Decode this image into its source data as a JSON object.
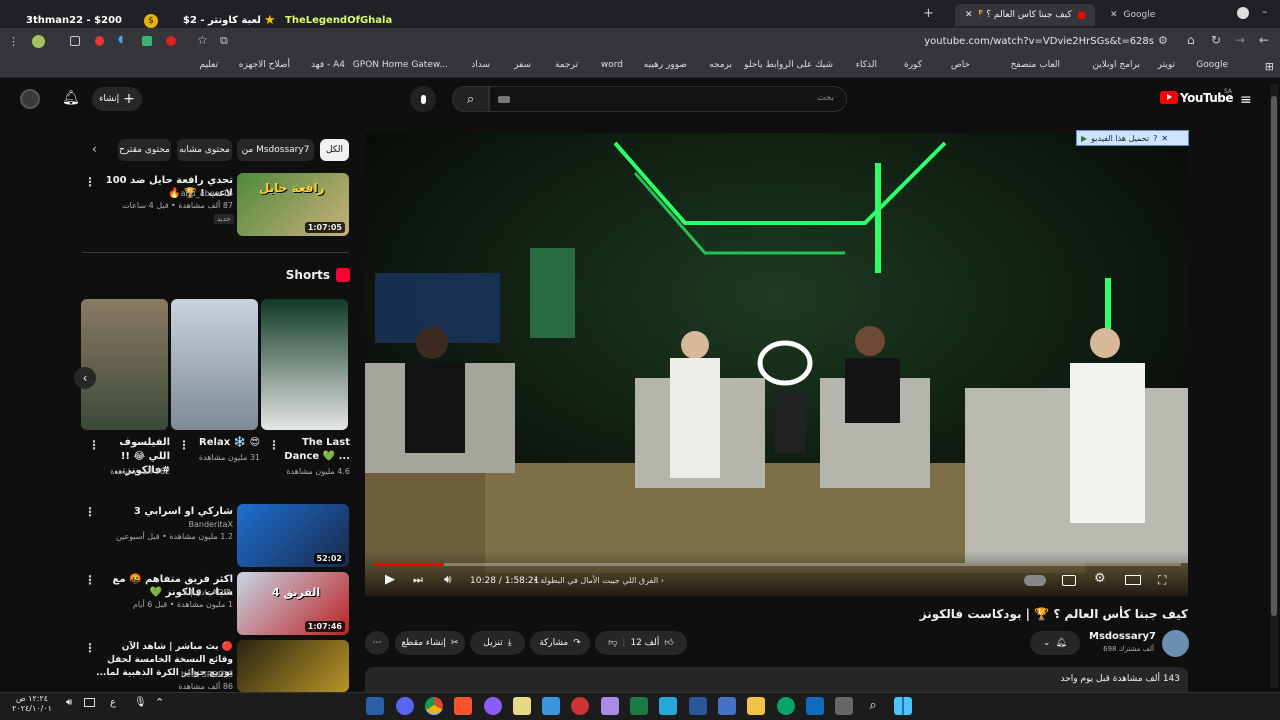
{
  "browser": {
    "tabs": [
      {
        "title": "كيف جبنا كأس العالم ؟ 🏆 | بودكا",
        "active": true
      },
      {
        "title": "Google",
        "active": false
      }
    ],
    "url": "youtube.com/watch?v=VDvie2HrSGs&t=628s",
    "bookmarks": [
      "Google",
      "تويتر",
      "برامج اونلاين",
      "العاب متصفح",
      "خاص",
      "كورة",
      "الذكاء",
      "شيك على الروابط ياحلو",
      "برمجه",
      "صوور رهيبه",
      "word",
      "ترجمة",
      "سفر",
      "سداد",
      "GPON Home Gatew...",
      "فهد - A4",
      "أصلاح الاجهزه",
      "تعليم"
    ]
  },
  "overlay": {
    "balance": "3thman22 - $200",
    "game": "لعبة كاونتر - 2$",
    "streamer": "TheLegendOfGhala"
  },
  "header": {
    "logo": "YouTube",
    "region": "SA",
    "search_placeholder": "بحث",
    "create_label": "إنشاء"
  },
  "player": {
    "time": "10:28 / 1:58:21",
    "chapter": "الفرق اللي جيبت الأمال في البطولة",
    "download_banner": "تحميل هذا الفيديو",
    "progress": 0.088
  },
  "video": {
    "title": "كيف جبنا كأس العالم ؟ 🏆 | بودكاست فالكونز",
    "channel": "Msdossary7",
    "subscribers": "698 ألف مشترك",
    "likes": "12 ألف",
    "share_label": "مشاركة",
    "download_label": "تنزيل",
    "clip_label": "إنشاء مقطع",
    "views_line": "143 ألف مشاهدة  قبل يوم واحد"
  },
  "chips": [
    "الكل",
    "من Msdossary7",
    "محتوى مشابه",
    "محتوى مقترح"
  ],
  "sidebar_videos": [
    {
      "title": "تحدي رافعة حايل ضد 100 لاعب ! 🏆 🔥",
      "channel": "abu_abeer16",
      "meta": "87 ألف مشاهدة • قبل 4 ساعات",
      "badge": "جديد",
      "duration": "1:07:05",
      "thumb_text": "رافعة حايل"
    },
    {
      "title": "شاركي او اسرابي 3",
      "channel": "BanderitaX",
      "meta": "1.2 مليون مشاهدة • قبل أسبوعين",
      "duration": "52:02"
    },
    {
      "title": "اكثر فريق متفاهم 🤬 مع شباب فالكونز 💚",
      "channel": "عادل | 3ADEL",
      "meta": "1 مليون مشاهدة • قبل 6 أيام",
      "duration": "1:07:46",
      "thumb_text": "الفريق 4"
    },
    {
      "title": "🔴 بث مباشر | شاهد الآن وقائع النسخة الخامسة لحفل توزيع جوائز الكرة الذهبية لما...",
      "channel": "beIN SPORTS",
      "meta": "86 ألف مشاهدة"
    }
  ],
  "shorts_header": "Shorts",
  "shorts": [
    {
      "title": "The Last Dance 💚 ...",
      "views": "4.6 مليون مشاهدة"
    },
    {
      "title": "Relax ❄️ 😍",
      "views": "31 مليون مشاهدة"
    },
    {
      "title": "الفيلسوف اللي 😂 !! #فالكونز...",
      "views": "562 ألف مشاهدة"
    }
  ],
  "taskbar": {
    "time": "١٢:٢٤ ص",
    "date": "٢٠٢٤/١٠/٠١",
    "lang": "ع"
  },
  "colors": {
    "accent": "#ff0000",
    "bg": "#0f0f0f",
    "chip": "#272727"
  }
}
